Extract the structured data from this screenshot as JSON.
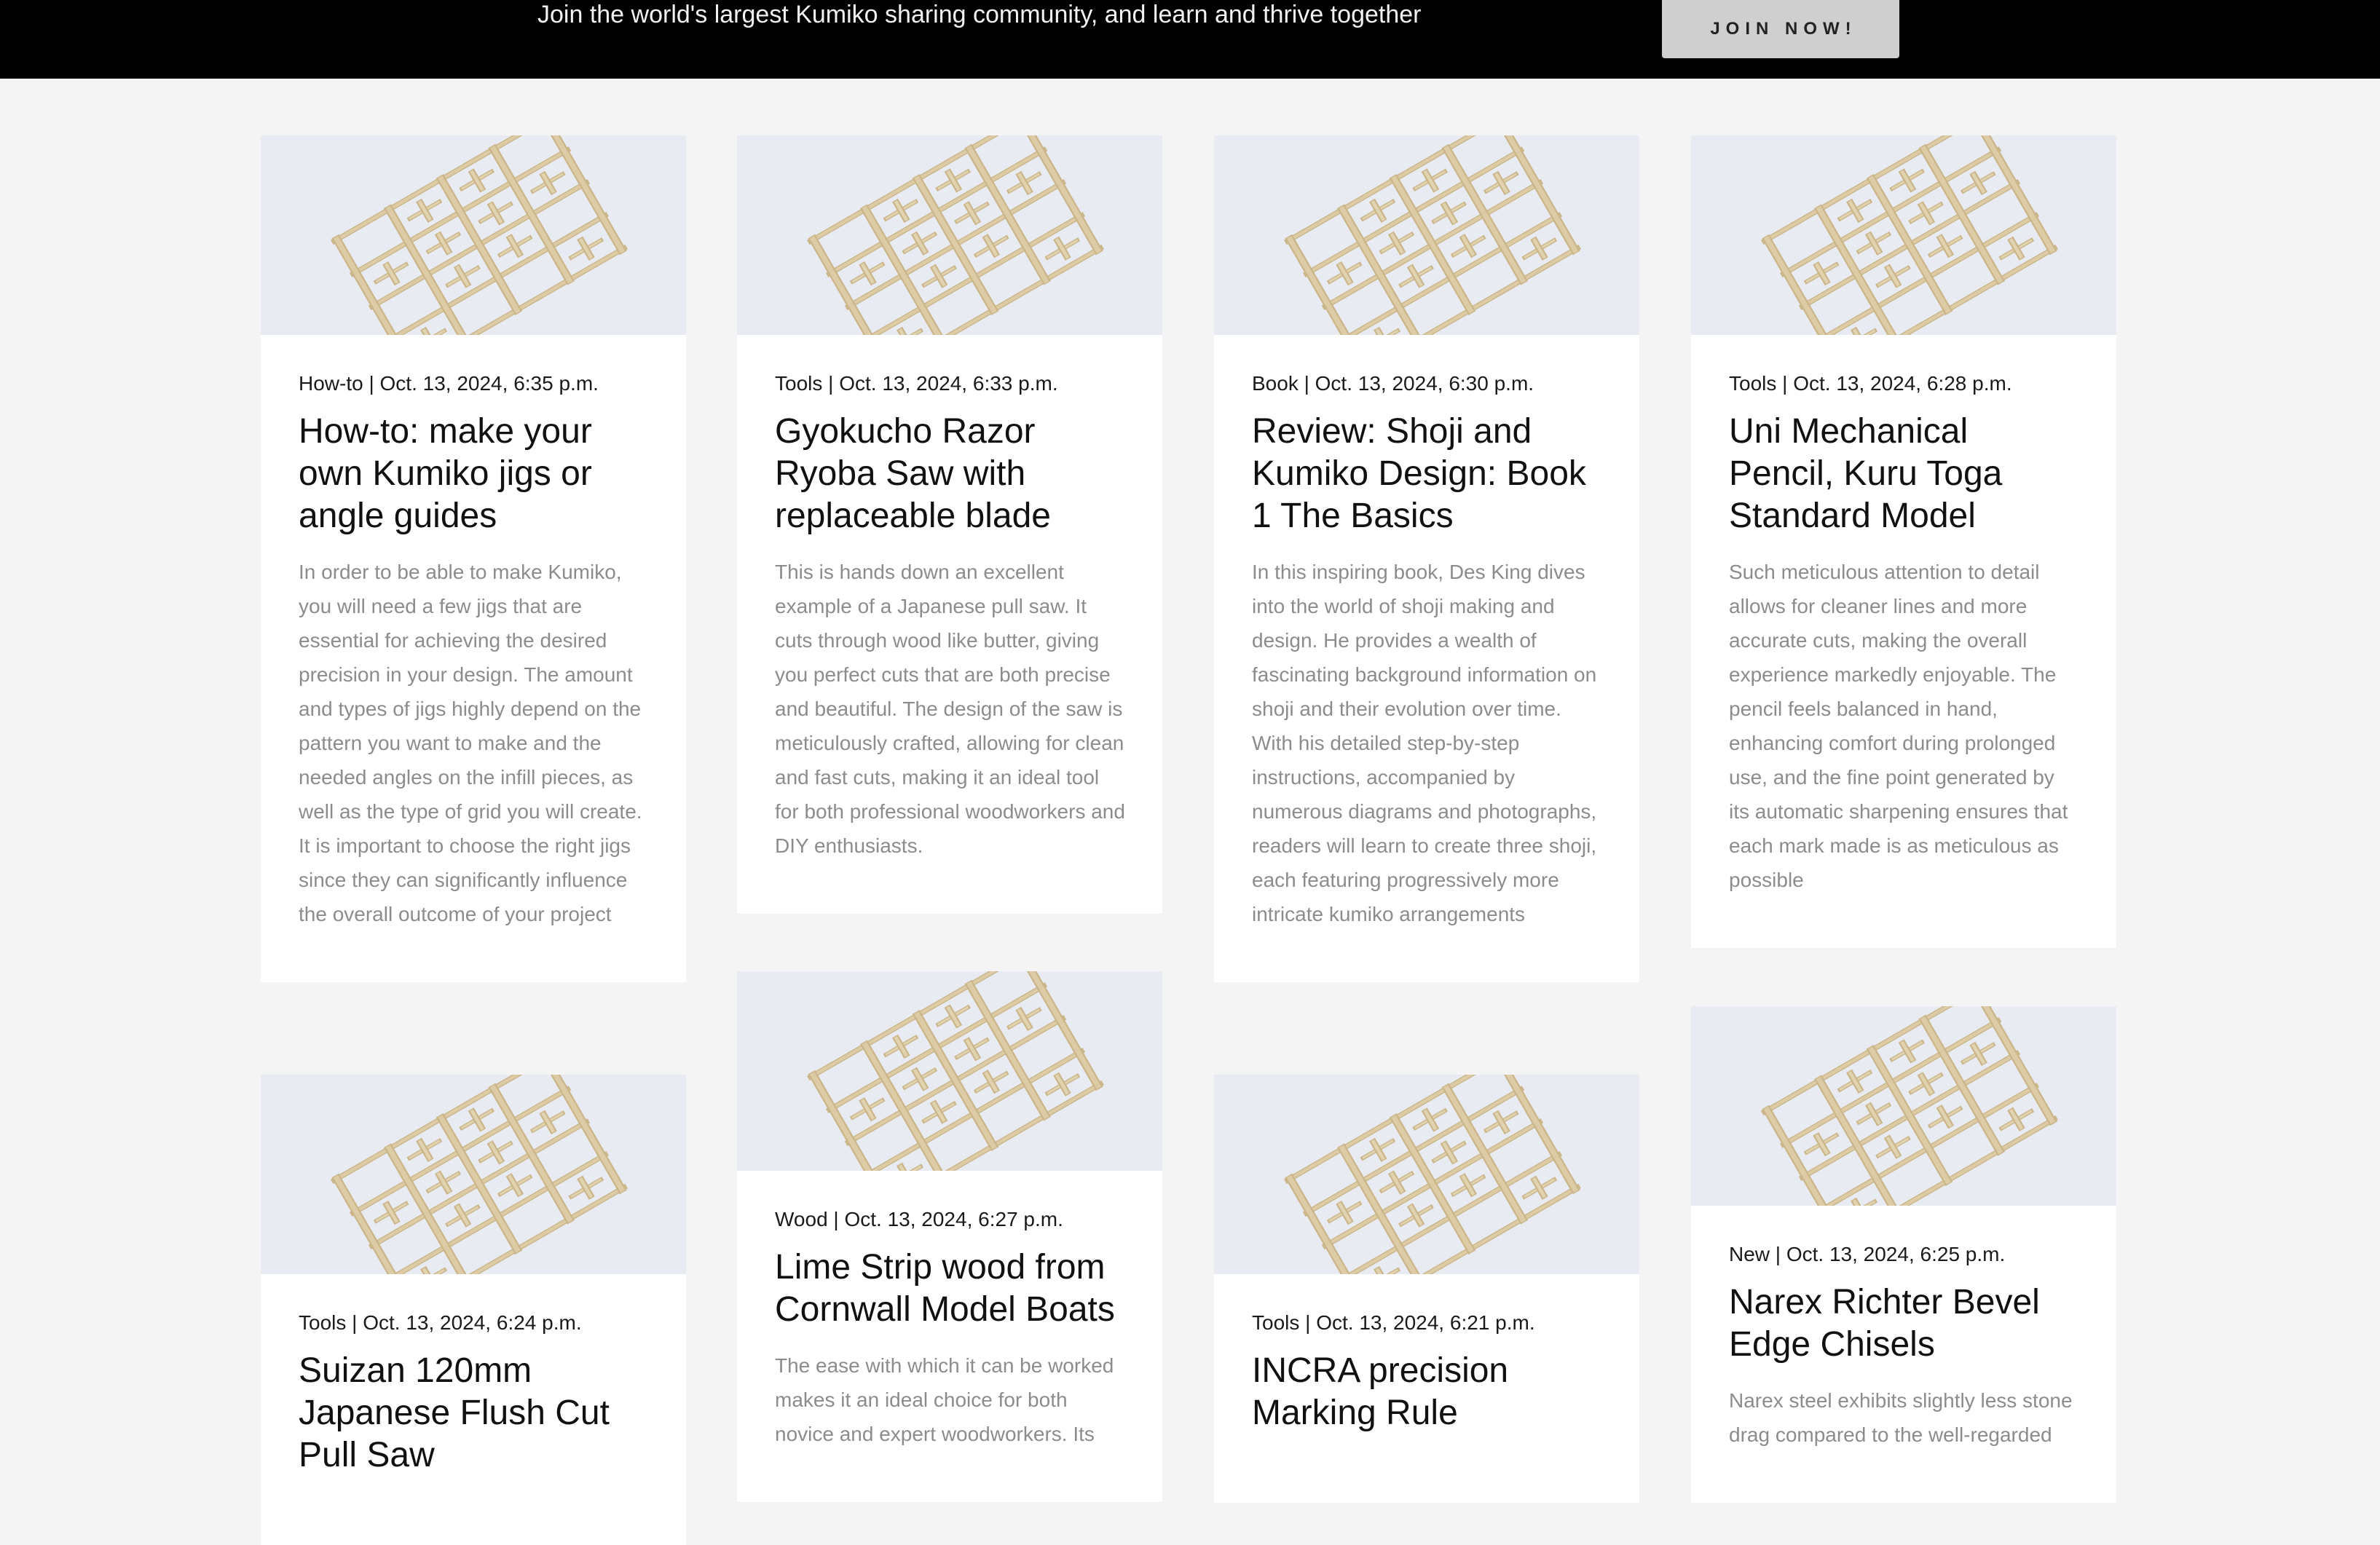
{
  "banner": {
    "tagline": "Join the world's largest Kumiko sharing community, and learn and thrive together",
    "join_label": "JOIN NOW!"
  },
  "colors": {
    "topbar": "#000000",
    "page_background": "#f4f4f4",
    "card_background": "#ffffff",
    "thumbnail_background": "#e9ebf2",
    "wood": "#d9c7a0"
  },
  "posts": [
    {
      "meta": "How-to | Oct. 13, 2024, 6:35 p.m.",
      "title": "How-to: make your own Kumiko jigs or angle guides",
      "excerpt": "In order to be able to make Kumiko, you will need a few jigs that are essential for achieving the desired precision in your design. The amount and types of jigs highly depend on the pattern you want to make and the needed angles on the infill pieces, as well as the type of grid you will create. It is important to choose the right jigs since they can significantly influence the overall outcome of your project"
    },
    {
      "meta": "Tools | Oct. 13, 2024, 6:33 p.m.",
      "title": "Gyokucho Razor Ryoba Saw with replaceable blade",
      "excerpt": "This is hands down an excellent example of a Japanese pull saw. It cuts through wood like butter, giving you perfect cuts that are both precise and beautiful. The design of the saw is meticulously crafted, allowing for clean and fast cuts, making it an ideal tool for both professional woodworkers and DIY enthusiasts."
    },
    {
      "meta": "Book | Oct. 13, 2024, 6:30 p.m.",
      "title": "Review: Shoji and Kumiko Design: Book 1 The Basics",
      "excerpt": "In this inspiring book, Des King dives into the world of shoji making and design. He provides a wealth of fascinating background information on shoji and their evolution over time. With his detailed step-by-step instructions, accompanied by numerous diagrams and photographs, readers will learn to create three shoji, each featuring progressively more intricate kumiko arrangements"
    },
    {
      "meta": "Tools | Oct. 13, 2024, 6:28 p.m.",
      "title": "Uni Mechanical Pencil, Kuru Toga Standard Model",
      "excerpt": "Such meticulous attention to detail allows for cleaner lines and more accurate cuts, making the overall experience markedly enjoyable. The pencil feels balanced in hand, enhancing comfort during prolonged use, and the fine point generated by its automatic sharpening ensures that each mark made is as meticulous as possible"
    },
    {
      "meta": "Tools | Oct. 13, 2024, 6:24 p.m.",
      "title": "Suizan 120mm Japanese Flush Cut Pull Saw",
      "excerpt": ""
    },
    {
      "meta": "Wood | Oct. 13, 2024, 6:27 p.m.",
      "title": "Lime Strip wood from Cornwall Model Boats",
      "excerpt": "The ease with which it can be worked makes it an ideal choice for both novice and expert woodworkers. Its"
    },
    {
      "meta": "Tools | Oct. 13, 2024, 6:21 p.m.",
      "title": "INCRA precision Marking Rule",
      "excerpt": ""
    },
    {
      "meta": "New | Oct. 13, 2024, 6:25 p.m.",
      "title": "Narex Richter Bevel Edge Chisels",
      "excerpt": "Narex steel exhibits slightly less stone drag compared to the well-regarded"
    }
  ]
}
